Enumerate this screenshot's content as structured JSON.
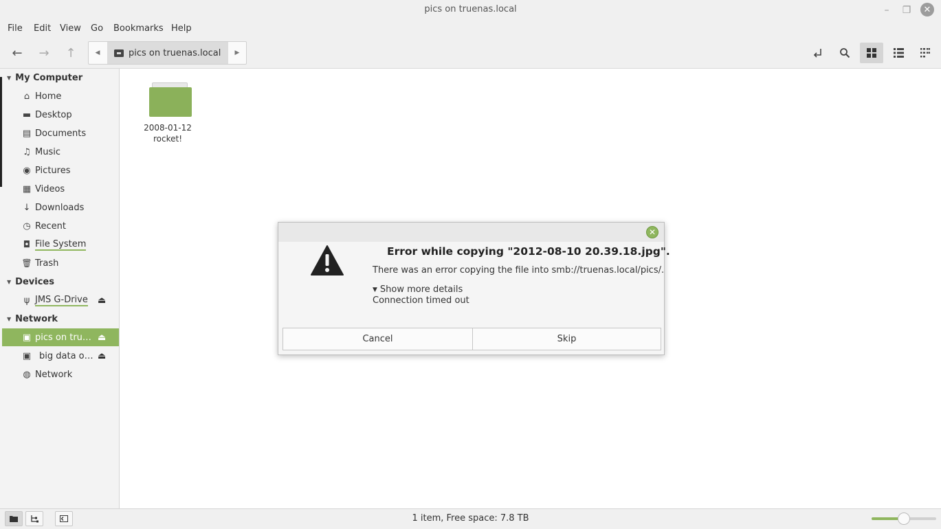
{
  "window": {
    "title": "pics on truenas.local",
    "min_glyph": "–",
    "max_glyph": "❐",
    "close_glyph": "✕"
  },
  "menu": [
    "File",
    "Edit",
    "View",
    "Go",
    "Bookmarks",
    "Help"
  ],
  "toolbar": {
    "back_glyph": "←",
    "forward_glyph": "→",
    "up_glyph": "↑",
    "path_left_glyph": "◀",
    "path_right_glyph": "▶",
    "breadcrumb": "pics on truenas.local",
    "icons": [
      "back-icon",
      "forward-icon",
      "up-icon",
      "toggle-location-icon",
      "search-icon",
      "icon-view-icon",
      "list-view-icon",
      "compact-view-icon"
    ]
  },
  "sidebar": {
    "sections": {
      "my_computer": "My Computer",
      "devices": "Devices",
      "network": "Network"
    },
    "items": {
      "home": "Home",
      "desktop": "Desktop",
      "documents": "Documents",
      "music": "Music",
      "pictures": "Pictures",
      "videos": "Videos",
      "downloads": "Downloads",
      "recent": "Recent",
      "filesystem": "File System",
      "trash": "Trash",
      "jms": "JMS G-Drive",
      "pics": "pics on tru…",
      "bigdata": "big data o…",
      "network": "Network"
    },
    "glyphs": {
      "home": "⌂",
      "desktop": "▬",
      "documents": "▤",
      "music": "♫",
      "pictures": "◉",
      "videos": "▦",
      "downloads": "↓",
      "recent": "◷",
      "filesystem": "◘",
      "trash": "🗑",
      "jms": "ψ",
      "pics": "▣",
      "bigdata": "▣",
      "network": "◍",
      "eject": "⏏",
      "expand": "▼"
    }
  },
  "content": {
    "folders": [
      {
        "name_line1": "2008-01-12",
        "name_line2": "rocket!"
      }
    ]
  },
  "status": {
    "text": "1 item, Free space: 7.8 TB",
    "zoom_level": 0.5
  },
  "dialog": {
    "heading": "Error while copying \"2012-08-10 20.39.18.jpg\".",
    "body": "There was an error copying the file into smb://truenas.local/pics/.",
    "details_toggle": "Show more details",
    "details_glyph": "▼",
    "details_text": "Connection timed out",
    "cancel_label": "Cancel",
    "skip_label": "Skip",
    "close_glyph": "✕"
  },
  "colors": {
    "accent": "#8fb65e",
    "folder": "#8bb15a"
  }
}
